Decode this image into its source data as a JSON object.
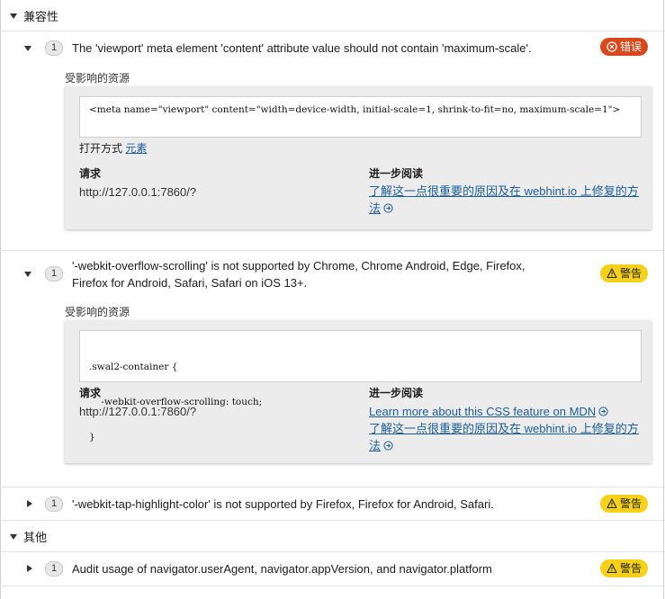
{
  "sections": [
    {
      "title": "兼容性",
      "issues": [
        {
          "count": "1",
          "message": "The 'viewport' meta element 'content' attribute value should not contain 'maximum-scale'.",
          "badge": "错误",
          "severity": "error",
          "resources_label": "受影响的资源",
          "code": "<meta name=\"viewport\" content=\"width=device-width, initial-scale=1, shrink-to-fit=no, maximum-scale=1\">",
          "open_with_prefix": "打开方式",
          "open_with_link": "元素",
          "request_label": "请求",
          "request_url": "http://127.0.0.1:7860/?",
          "further_label": "进一步阅读",
          "further_links": [
            "了解这一点很重要的原因及在 webhint.io 上修复的方法"
          ]
        },
        {
          "count": "1",
          "message_line1": "'-webkit-overflow-scrolling' is not supported by Chrome, Chrome Android, Edge, Firefox,",
          "message_line2": "Firefox for Android, Safari, Safari on iOS 13+.",
          "badge": "警告",
          "severity": "warning",
          "resources_label": "受影响的资源",
          "code_line1": ".swal2-container {",
          "code_line2": "    -webkit-overflow-scrolling: touch;",
          "code_line3": "}",
          "request_label": "请求",
          "request_url": "http://127.0.0.1:7860/?",
          "further_label": "进一步阅读",
          "further_links": [
            "Learn more about this CSS feature on MDN",
            "了解这一点很重要的原因及在 webhint.io 上修复的方法"
          ]
        },
        {
          "count": "1",
          "message": "'-webkit-tap-highlight-color' is not supported by Firefox, Firefox for Android, Safari.",
          "badge": "警告",
          "severity": "warning"
        }
      ]
    },
    {
      "title": "其他",
      "issues": [
        {
          "count": "1",
          "message": "Audit usage of navigator.userAgent, navigator.appVersion, and navigator.platform",
          "badge": "警告",
          "severity": "warning"
        }
      ]
    }
  ],
  "colors": {
    "error": "#d9481c",
    "warning": "#f7d117",
    "link": "#1b5e9c"
  }
}
